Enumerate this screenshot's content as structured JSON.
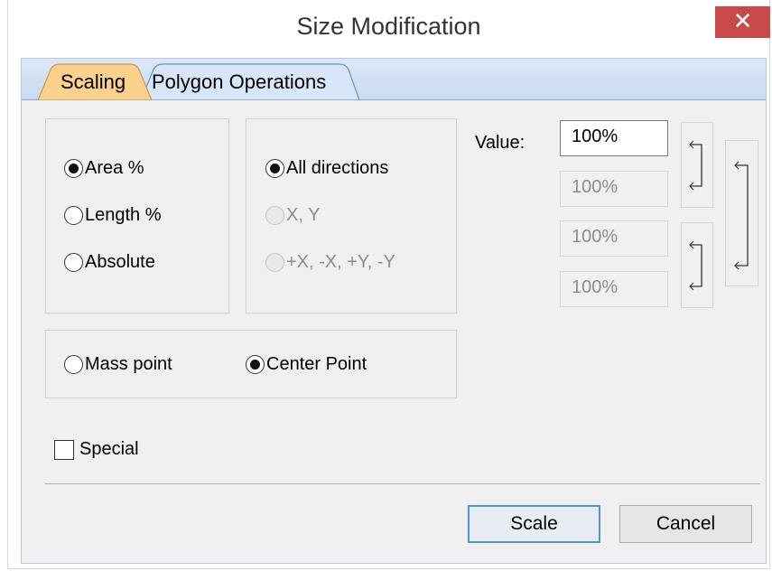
{
  "window": {
    "title": "Size Modification",
    "close_glyph": "✕"
  },
  "tabs": [
    {
      "label": "Scaling",
      "active": true
    },
    {
      "label": "Polygon Operations",
      "active": false
    }
  ],
  "scaling_mode": {
    "options": [
      {
        "label": "Area %",
        "selected": true,
        "enabled": true
      },
      {
        "label": "Length %",
        "selected": false,
        "enabled": true
      },
      {
        "label": "Absolute",
        "selected": false,
        "enabled": true
      }
    ]
  },
  "direction": {
    "options": [
      {
        "label": "All directions",
        "selected": true,
        "enabled": true
      },
      {
        "label": "X, Y",
        "selected": false,
        "enabled": false
      },
      {
        "label": "+X, -X, +Y, -Y",
        "selected": false,
        "enabled": false
      }
    ]
  },
  "reference_point": {
    "options": [
      {
        "label": "Mass point",
        "selected": false
      },
      {
        "label": "Center Point",
        "selected": true
      }
    ]
  },
  "values": {
    "label": "Value:",
    "fields": [
      "100%",
      "100%",
      "100%",
      "100%"
    ]
  },
  "special": {
    "label": "Special",
    "checked": false
  },
  "buttons": {
    "scale": "Scale",
    "cancel": "Cancel"
  },
  "colors": {
    "close_bg": "#c94a48",
    "active_tab": "#fbd18e",
    "default_button_border": "#4f95d8"
  }
}
